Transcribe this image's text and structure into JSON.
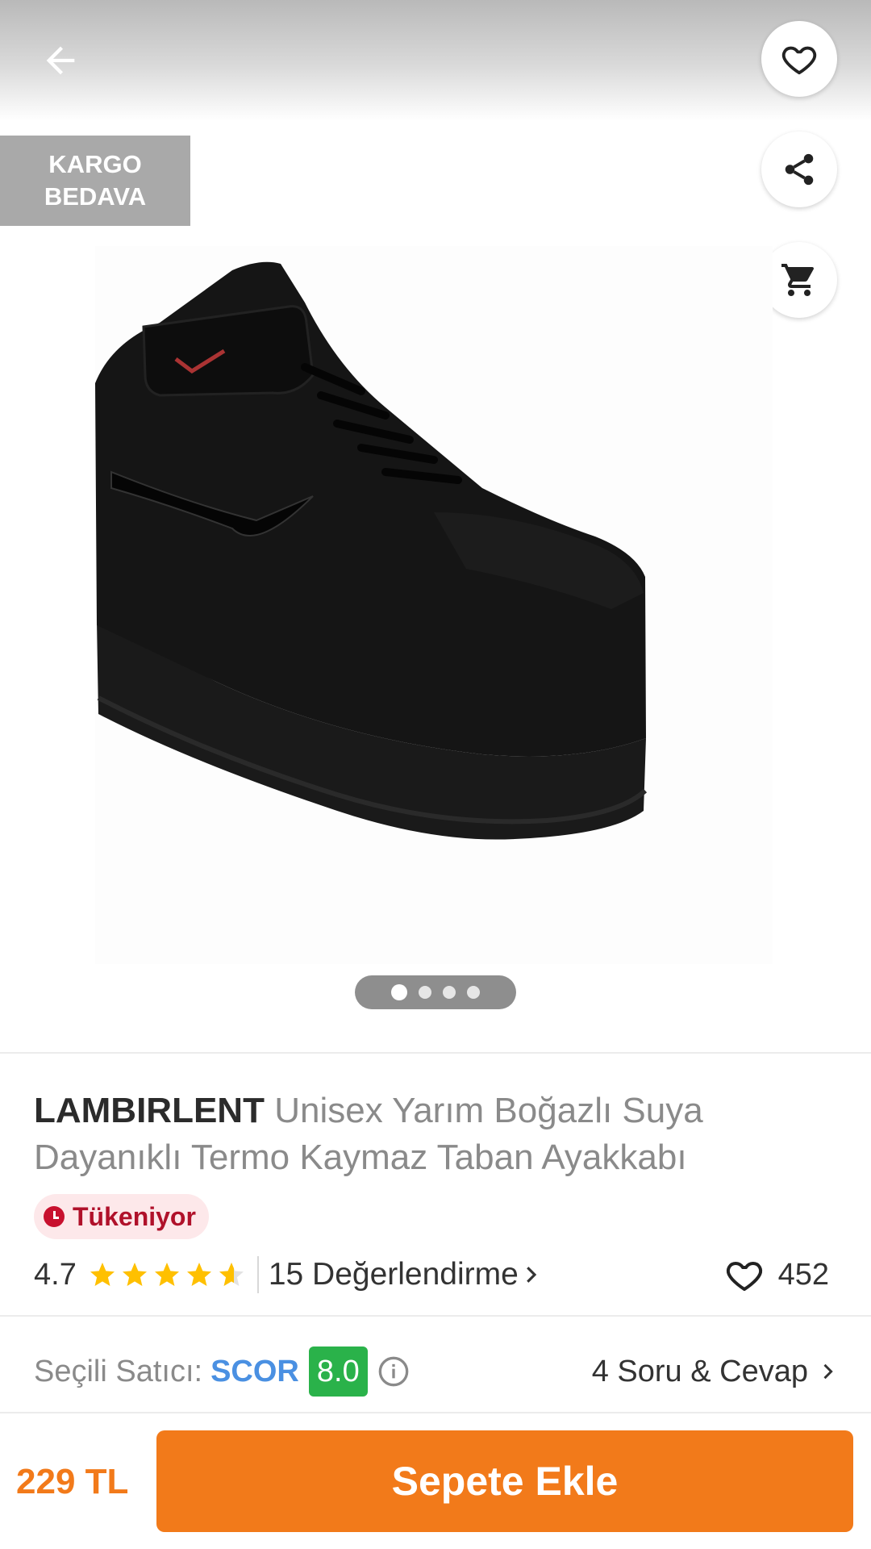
{
  "header": {
    "back_icon": "arrow-left-icon",
    "favorite_icon": "heart-icon",
    "share_icon": "share-icon",
    "cart_icon": "cart-icon"
  },
  "badge_shipping": {
    "line1": "KARGO",
    "line2": "BEDAVA"
  },
  "gallery": {
    "image_description": "black high-top sneaker",
    "page_count": 4,
    "active_page": 1
  },
  "product": {
    "brand": "LAMBIRLENT",
    "name": "Unisex Yarım Boğazlı Suya Dayanıklı Termo Kaymaz Taban Ayakkabı",
    "stock_badge": "Tükeniyor",
    "rating": "4.7",
    "rating_value": 4.7,
    "reviews_label": "15 Değerlendirme",
    "favorites_count": "452"
  },
  "seller": {
    "label": "Seçili Satıcı:",
    "name": "SCOR",
    "score": "8.0",
    "qa_label": "4 Soru & Cevap"
  },
  "footer": {
    "price": "229 TL",
    "add_to_cart_label": "Sepete Ekle"
  },
  "colors": {
    "accent": "#f27a1a",
    "star": "#ffc000",
    "seller_link": "#4a90e2",
    "score_bg": "#2ab24a",
    "stock_text": "#b0112a"
  }
}
